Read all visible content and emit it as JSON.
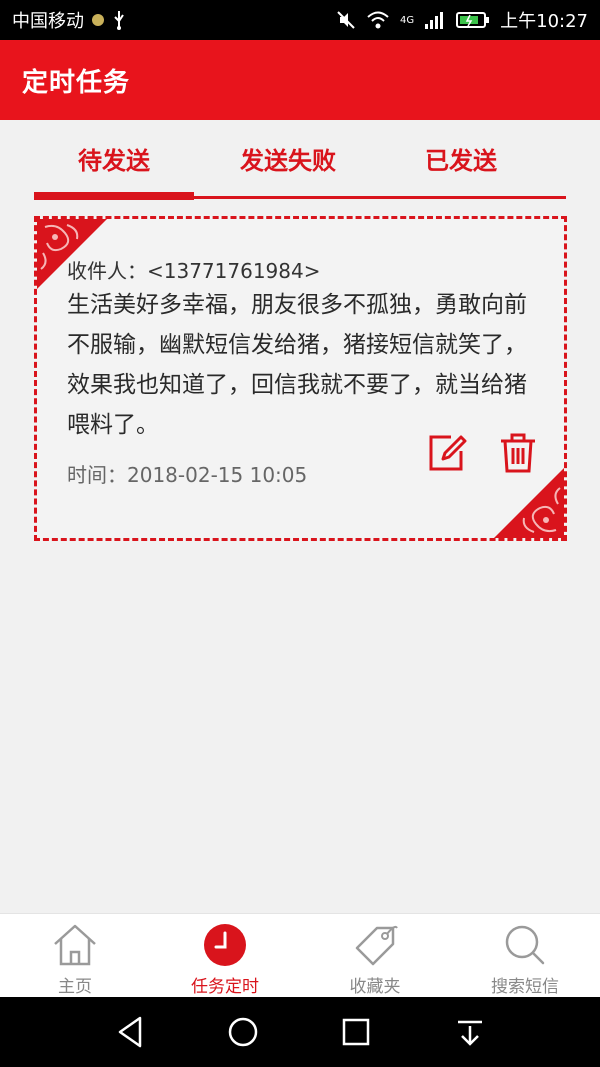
{
  "status_bar": {
    "carrier": "中国移动",
    "network": "4G",
    "time": "上午10:27"
  },
  "header": {
    "title": "定时任务"
  },
  "tabs": [
    {
      "label": "待发送",
      "active": true
    },
    {
      "label": "发送失败",
      "active": false
    },
    {
      "label": "已发送",
      "active": false
    }
  ],
  "task": {
    "recipient_label": "收件人：",
    "recipient_number": "<13771761984>",
    "message": "生活美好多幸福，朋友很多不孤独，勇敢向前不服输，幽默短信发给猪，猪接短信就笑了，效果我也知道了，回信我就不要了，就当给猪喂料了。",
    "time_label": "时间：",
    "time_value": "2018-02-15 10:05"
  },
  "bottom_nav": [
    {
      "label": "主页",
      "icon": "home-icon",
      "active": false
    },
    {
      "label": "任务定时",
      "icon": "clock-icon",
      "active": true
    },
    {
      "label": "收藏夹",
      "icon": "tag-icon",
      "active": false
    },
    {
      "label": "搜索短信",
      "icon": "search-icon",
      "active": false
    }
  ],
  "colors": {
    "primary_red": "#e8141c",
    "accent_red": "#d9141c",
    "background": "#f1f1f1"
  }
}
